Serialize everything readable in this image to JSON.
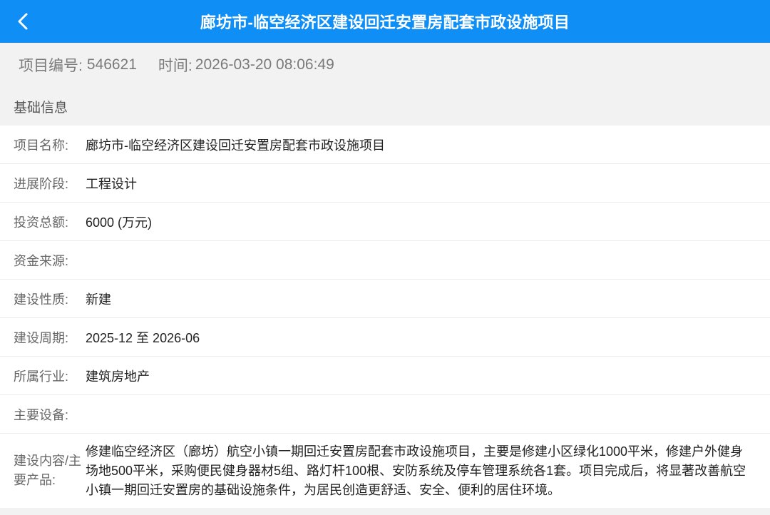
{
  "header": {
    "title": "廊坊市-临空经济区建设回迁安置房配套市政设施项目"
  },
  "meta": {
    "id_label": "项目编号:",
    "id_value": "546621",
    "time_label": "时间:",
    "time_value": "2026-03-20 08:06:49"
  },
  "section": {
    "title": "基础信息"
  },
  "rows": [
    {
      "label": "项目名称:",
      "value": "廊坊市-临空经济区建设回迁安置房配套市政设施项目"
    },
    {
      "label": "进展阶段:",
      "value": "工程设计"
    },
    {
      "label": "投资总额:",
      "value": "6000 (万元)"
    },
    {
      "label": "资金来源:",
      "value": ""
    },
    {
      "label": "建设性质:",
      "value": "新建"
    },
    {
      "label": "建设周期:",
      "value": "2025-12 至 2026-06"
    },
    {
      "label": "所属行业:",
      "value": "建筑房地产"
    },
    {
      "label": "主要设备:",
      "value": ""
    },
    {
      "label": "建设内容/主要产品:",
      "value": "修建临空经济区（廊坊）航空小镇一期回迁安置房配套市政设施项目，主要是修建小区绿化1000平米，修建户外健身场地500平米，采购便民健身器材5组、路灯杆100根、安防系统及停车管理系统各1套。项目完成后，将显著改善航空小镇一期回迁安置房的基础设施条件，为居民创造更舒适、安全、便利的居住环境。"
    }
  ],
  "colors": {
    "header_bg": "#0f8ef5",
    "page_bg": "#f2f2f2"
  },
  "icons": {
    "back": "chevron-left-icon"
  }
}
